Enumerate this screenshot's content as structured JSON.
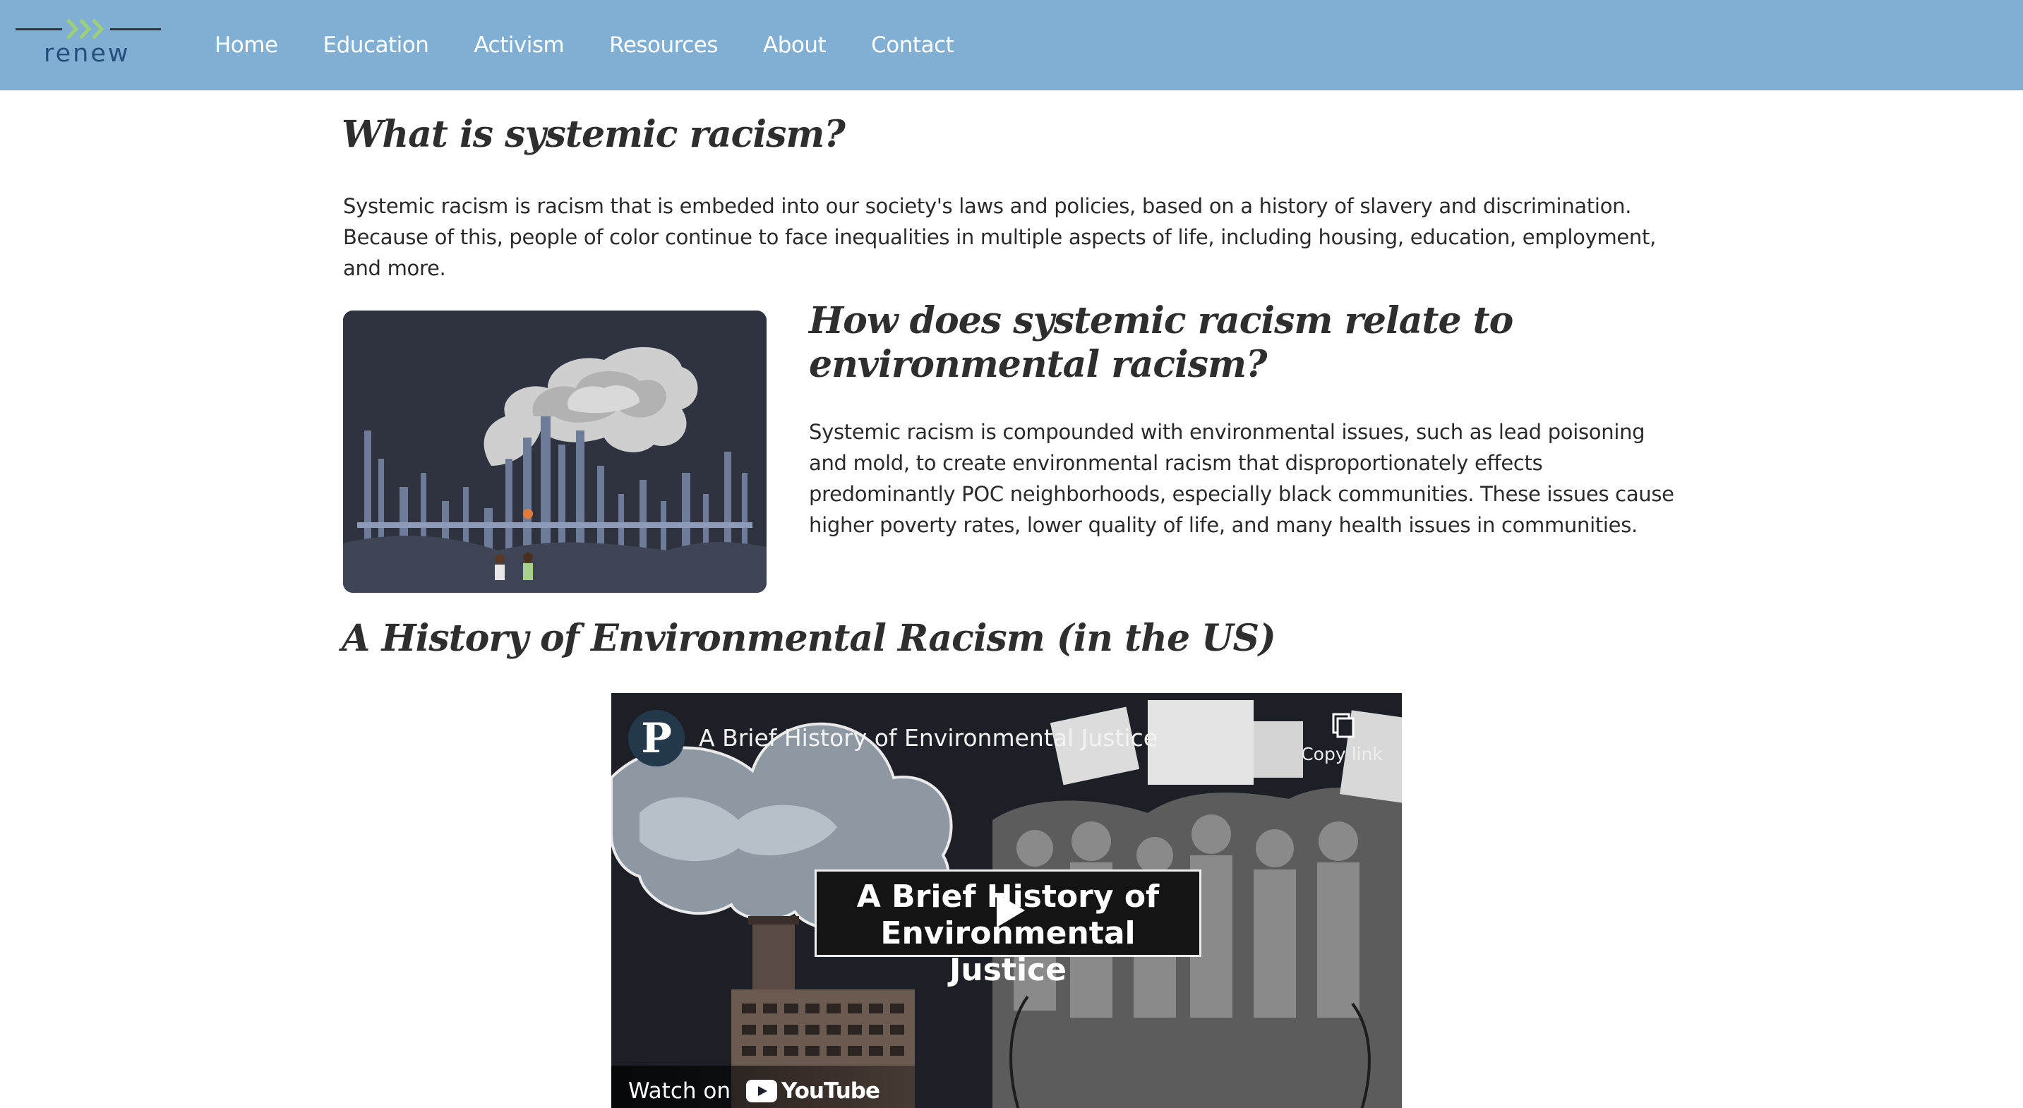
{
  "brand": {
    "logo_text": "renew",
    "logo_icon": "chevrons-icon"
  },
  "nav": {
    "items": [
      {
        "label": "Home"
      },
      {
        "label": "Education"
      },
      {
        "label": "Activism"
      },
      {
        "label": "Resources"
      },
      {
        "label": "About"
      },
      {
        "label": "Contact"
      }
    ]
  },
  "colors": {
    "nav_bg": "#80afd3",
    "logo_text": "#244f7a",
    "logo_chevrons": "#9bcf7a",
    "heading": "#2e2e2e"
  },
  "sections": {
    "what": {
      "heading": "What is systemic racism?",
      "body": "Systemic racism is racism that is embeded into our society's laws and policies, based on a history of slavery and discrimination. Because of this, people of color continue to face inequalities in multiple aspects of life, including housing, education, employment, and more."
    },
    "how": {
      "heading": "How does systemic racism relate to environmental racism?",
      "body": "Systemic racism is compounded with environmental issues, such as lead poisoning and mold, to create environmental racism that disproportionately effects predominantly POC neighborhoods, especially black communities. These issues cause higher poverty rates, lower quality of life, and many health issues in communities.",
      "image_name": "factory-smokestacks-illustration"
    },
    "history": {
      "heading": "A History of Environmental Racism (in the US)"
    }
  },
  "video": {
    "title": "A Brief History of Environmental Justice",
    "channel_initial": "P",
    "copy_link_label": "Copy link",
    "card_title_line1": "A Brief History of",
    "card_title_line2": "Environmental Justice",
    "watch_on_label": "Watch on",
    "platform_label": "YouTube"
  }
}
